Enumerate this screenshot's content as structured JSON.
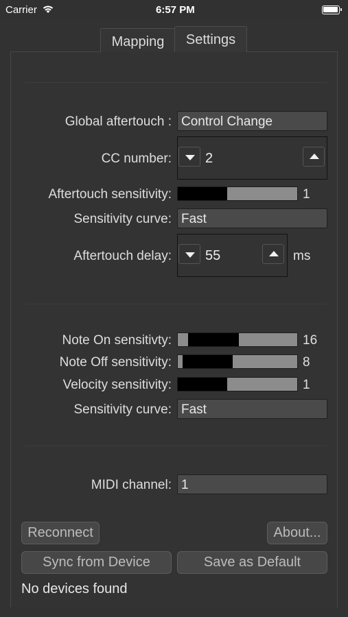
{
  "status": {
    "carrier": "Carrier",
    "time": "6:57 PM"
  },
  "tabs": [
    {
      "label": "Mapping"
    },
    {
      "label": "Settings"
    }
  ],
  "aftertouch": {
    "global_label": "Global aftertouch :",
    "global_value": "Control Change",
    "cc_label": "CC number:",
    "cc_value": "2",
    "sensitivity_label": "Aftertouch sensitivity:",
    "sensitivity_value": "1",
    "sensitivity_level": 0.4,
    "curve_label": "Sensitivity curve:",
    "curve_value": "Fast",
    "delay_label": "Aftertouch delay:",
    "delay_value": "55",
    "delay_unit": "ms"
  },
  "velocity": {
    "note_on_label": "Note On sensitivty:",
    "note_on_value": "16",
    "note_off_label": "Note Off sensitivity:",
    "note_off_value": "8",
    "velocity_label": "Velocity sensitivity:",
    "velocity_value": "1",
    "curve_label": "Sensitivity curve:",
    "curve_value": "Fast"
  },
  "midi": {
    "channel_label": "MIDI channel:",
    "channel_value": "1"
  },
  "buttons": {
    "reconnect": "Reconnect",
    "about": "About...",
    "sync": "Sync from Device",
    "save_default": "Save as Default"
  },
  "footer_status": "No devices found",
  "colors": {
    "background": "#323232",
    "field": "#4a4a4a",
    "slider_track": "#8c8c8c",
    "slider_fill": "#000000"
  }
}
